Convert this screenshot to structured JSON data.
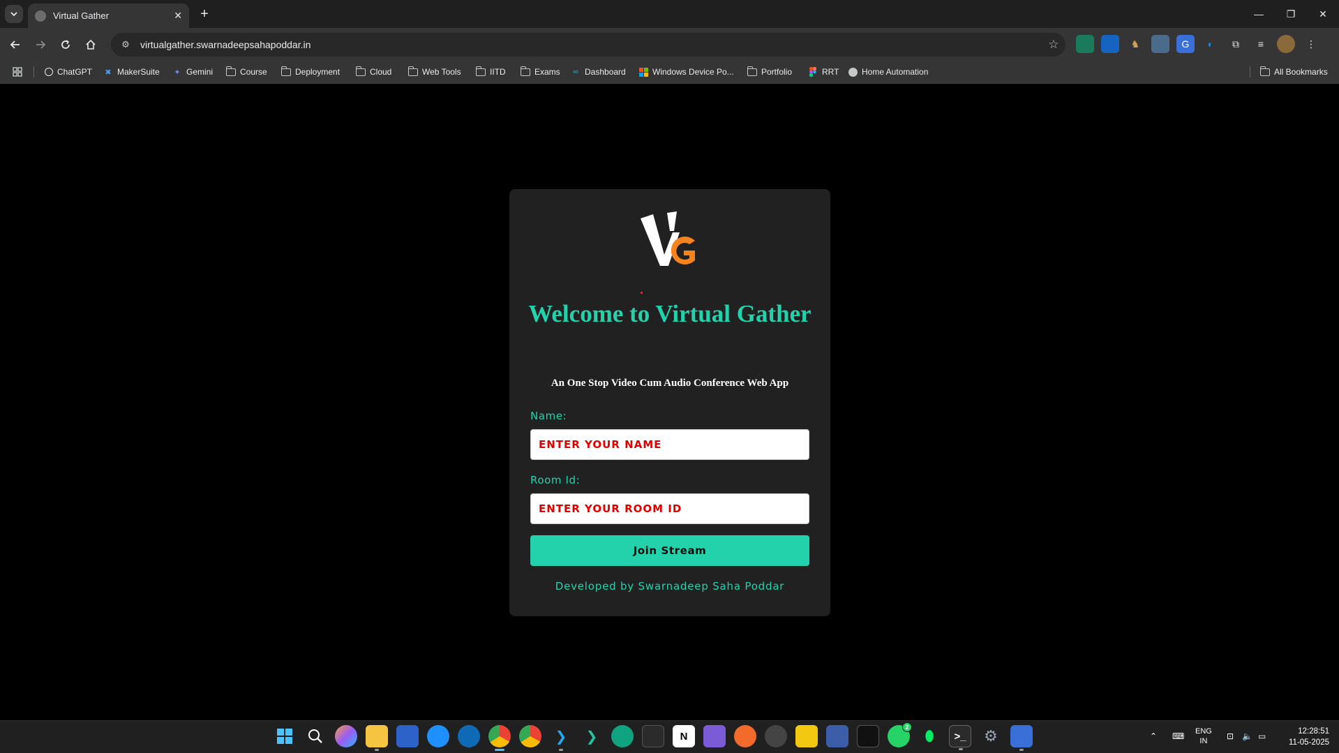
{
  "browser": {
    "tab_title": "Virtual Gather",
    "url": "virtualgather.swarnadeepsahapoddar.in",
    "bookmarks": [
      {
        "label": "ChatGPT",
        "icon": "chatgpt-icon"
      },
      {
        "label": "MakerSuite",
        "icon": "makersuite-icon"
      },
      {
        "label": "Gemini",
        "icon": "gemini-icon"
      },
      {
        "label": "Course",
        "icon": "folder-icon"
      },
      {
        "label": "Deployment",
        "icon": "folder-icon"
      },
      {
        "label": "Cloud",
        "icon": "folder-icon"
      },
      {
        "label": "Web Tools",
        "icon": "folder-icon"
      },
      {
        "label": "IITD",
        "icon": "folder-icon"
      },
      {
        "label": "Exams",
        "icon": "folder-icon"
      },
      {
        "label": "Dashboard",
        "icon": "dashboard-icon"
      },
      {
        "label": "Windows Device Po...",
        "icon": "windows-icon"
      },
      {
        "label": "Portfolio",
        "icon": "folder-icon"
      },
      {
        "label": "RRT",
        "icon": "figma-icon"
      },
      {
        "label": "Home Automation",
        "icon": "globe-icon"
      }
    ],
    "all_bookmarks": "All Bookmarks"
  },
  "app": {
    "logo_v": "V",
    "logo_g": "G",
    "welcome": "Welcome to Virtual Gather",
    "tagline": "An One Stop Video Cum Audio Conference Web App",
    "name_label": "Name:",
    "name_placeholder": "ENTER YOUR NAME",
    "room_label": "Room Id:",
    "room_placeholder": "ENTER YOUR ROOM ID",
    "join_label": "Join Stream",
    "credit": "Developed by Swarnadeep Saha Poddar"
  },
  "colors": {
    "accent": "#23d2aa",
    "placeholder": "#e00000",
    "card_bg": "#212121",
    "logo_orange": "#f5841f"
  },
  "taskbar": {
    "lang_top": "ENG",
    "lang_bottom": "IN",
    "time": "12:28:51",
    "date": "11-05-2025",
    "whatsapp_badge": "2"
  }
}
